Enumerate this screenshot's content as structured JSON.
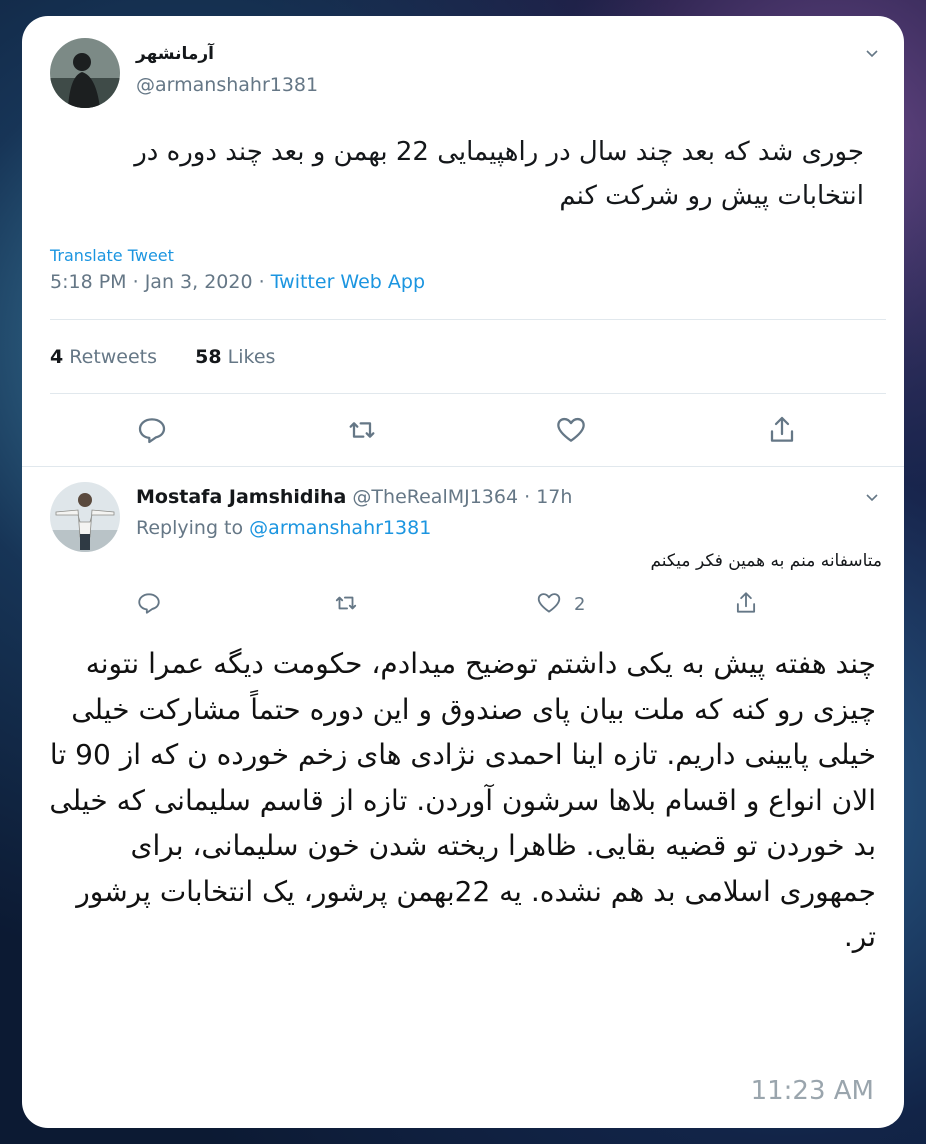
{
  "tweet": {
    "display_name": "آرمانشهر",
    "handle": "@armanshahr1381",
    "text": "جوری شد که بعد چند سال در راهپیمایی 22 بهمن و بعد چند دوره در انتخابات پیش رو شرکت کنم",
    "translate_label": "Translate Tweet",
    "time": "5:18 PM",
    "date": "Jan 3, 2020",
    "source": "Twitter Web App",
    "retweet_count": "4",
    "retweet_label": "Retweets",
    "like_count": "58",
    "like_label": "Likes"
  },
  "reply": {
    "display_name": "Mostafa Jamshidiha",
    "handle": "@TheRealMJ1364",
    "age": "17h",
    "replying_prefix": "Replying to",
    "replying_handle": "@armanshahr1381",
    "text": "متاسفانه منم به همین فکر میکنم",
    "like_count": "2"
  },
  "message": {
    "text": "چند هفته پیش به یکی داشتم توضیح میدادم، حکومت دیگه عمرا نتونه چیزی رو کنه که ملت بیان پای صندوق و این دوره حتماً مشارکت خیلی خیلی پایینی داریم. تازه اینا احمدی نژادی های زخم خورده ن که از 90 تا الان انواع و اقسام بلاها سرشون آوردن. تازه از قاسم سلیمانی که خیلی بد خوردن تو قضیه بقایی. ظاهرا ریخته شدن خون سلیمانی، برای جمهوری اسلامی بد هم نشده. یه 22بهمن پرشور، یک انتخابات پرشور تر.",
    "timestamp": "11:23 AM"
  },
  "icons": {
    "reply": "reply-icon",
    "retweet": "retweet-icon",
    "like": "heart-icon",
    "share": "share-icon",
    "more": "chevron-down-icon"
  },
  "colors": {
    "link": "#1b95e0",
    "muted": "#657786",
    "text": "#14171a"
  }
}
